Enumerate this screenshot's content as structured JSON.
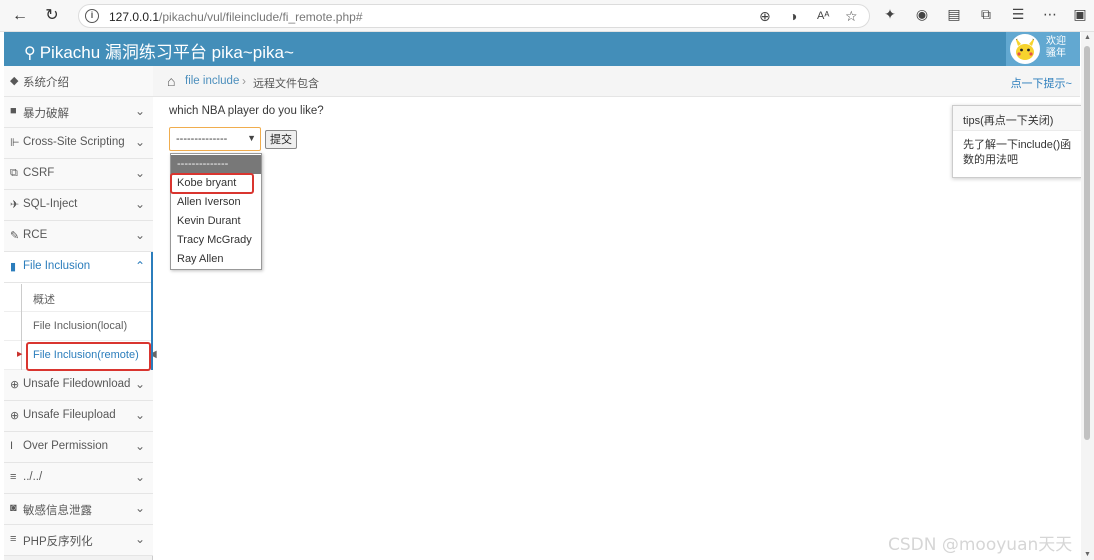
{
  "browser": {
    "back_icon": "←",
    "reload_icon": "↻",
    "url_host": "127.0.0.1",
    "url_path": "/pikachu/vul/fileinclude/fi_remote.php#"
  },
  "header": {
    "brand": "Pikachu 漏洞练习平台 pika~pika~",
    "user_line1": "欢迎",
    "user_line2": "骚年",
    "color": "#438eb9"
  },
  "sidebar": {
    "items": [
      {
        "label": "系统介绍",
        "icon": "tag-icon"
      },
      {
        "label": "暴力破解",
        "icon": "lock-icon"
      },
      {
        "label": "Cross-Site Scripting",
        "icon": "sitemap-icon"
      },
      {
        "label": "CSRF",
        "icon": "external-link-icon"
      },
      {
        "label": "SQL-Inject",
        "icon": "plane-icon"
      },
      {
        "label": "RCE",
        "icon": "wrench-icon"
      },
      {
        "label": "File Inclusion",
        "icon": "file-icon"
      },
      {
        "label": "Unsafe Filedownload",
        "icon": "download-icon"
      },
      {
        "label": "Unsafe Fileupload",
        "icon": "upload-icon"
      },
      {
        "label": "Over Permission",
        "icon": "text-cursor-icon"
      },
      {
        "label": "../../",
        "icon": "list-icon"
      },
      {
        "label": "敏感信息泄露",
        "icon": "camera-icon"
      },
      {
        "label": "PHP反序列化",
        "icon": "list-icon"
      }
    ],
    "sub_items": [
      {
        "label": "概述"
      },
      {
        "label": "File Inclusion(local)"
      },
      {
        "label": "File Inclusion(remote)"
      }
    ]
  },
  "breadcrumb": {
    "link": "file include",
    "separator": "›",
    "current": "远程文件包含",
    "hint": "点一下提示~"
  },
  "main": {
    "question": "which NBA player do you like?",
    "select_value": "--------------",
    "submit_label": "提交",
    "options": [
      "--------------",
      "Kobe bryant",
      "Allen Iverson",
      "Kevin Durant",
      "Tracy McGrady",
      "Ray Allen"
    ]
  },
  "tips": {
    "title": "tips(再点一下关闭)",
    "body": "先了解一下include()函数的用法吧"
  },
  "watermark": "CSDN @mooyuan天天"
}
